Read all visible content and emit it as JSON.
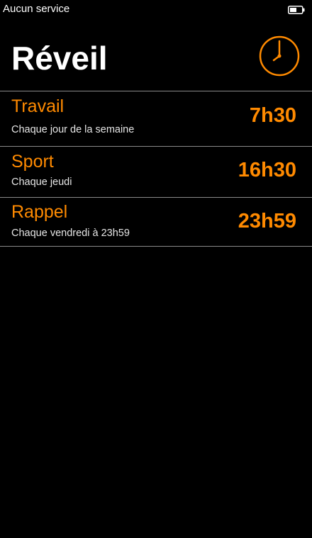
{
  "status_bar": {
    "carrier": "Aucun service",
    "battery_icon": "battery-icon"
  },
  "header": {
    "title": "Réveil",
    "clock_icon": "clock-icon"
  },
  "colors": {
    "accent": "#ff8a00",
    "background": "#000000",
    "divider": "#8a8a8a"
  },
  "alarms": [
    {
      "name": "Travail",
      "repeat": "Chaque jour de la semaine",
      "time": "7h30"
    },
    {
      "name": "Sport",
      "repeat": "Chaque jeudi",
      "time": "16h30"
    },
    {
      "name": "Rappel",
      "repeat": "Chaque vendredi à 23h59",
      "time": "23h59"
    }
  ]
}
